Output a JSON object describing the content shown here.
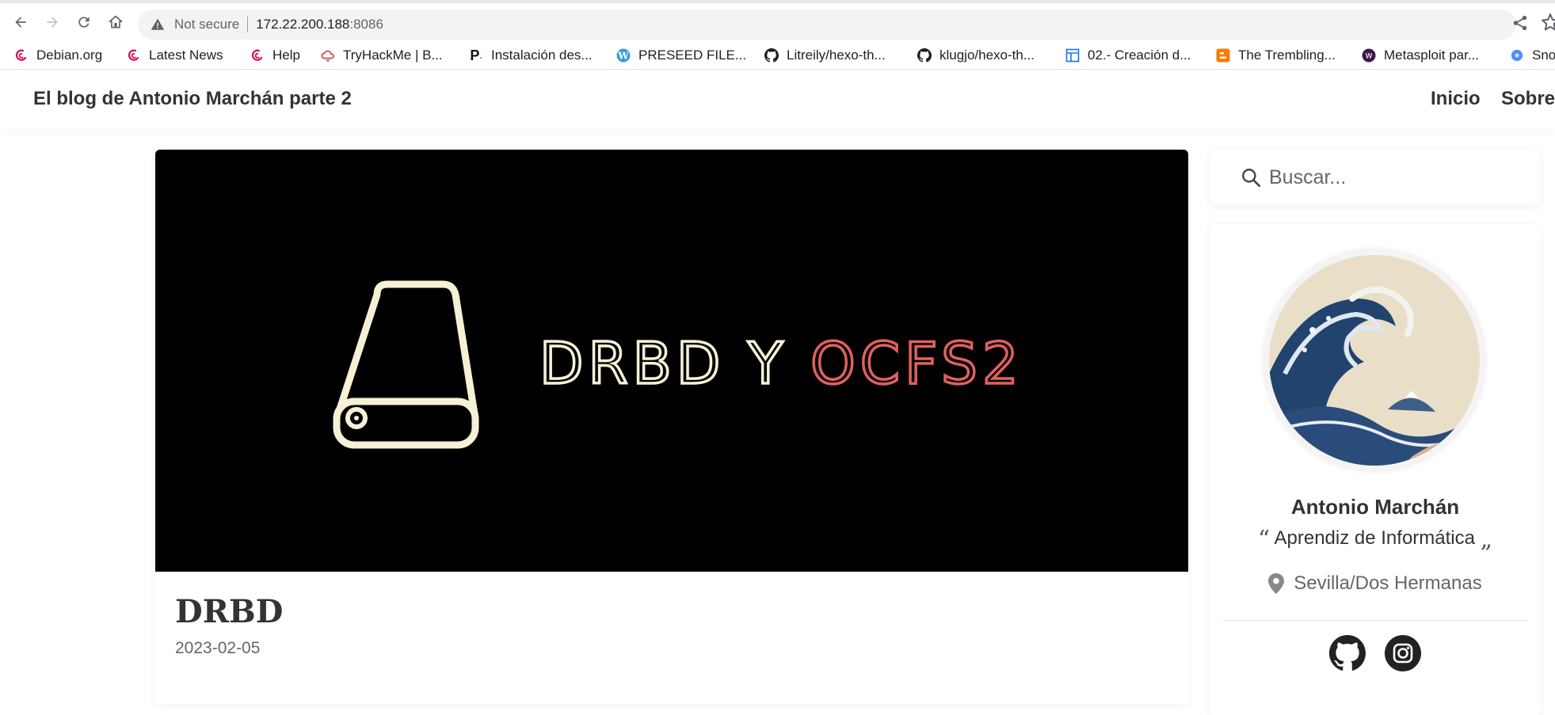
{
  "browser": {
    "security_label": "Not secure",
    "url_host": "172.22.200.188",
    "url_port": ":8086",
    "bookmarks": [
      {
        "label": "Debian.org",
        "icon": "debian-icon"
      },
      {
        "label": "Latest News",
        "icon": "debian-icon"
      },
      {
        "label": "Help",
        "icon": "debian-icon"
      },
      {
        "label": "TryHackMe | B...",
        "icon": "tryhackme-icon"
      },
      {
        "label": "Instalación des...",
        "icon": "p-logo-icon"
      },
      {
        "label": "PRESEED FILE...",
        "icon": "wordpress-icon"
      },
      {
        "label": "Litreily/hexo-th...",
        "icon": "github-icon"
      },
      {
        "label": "klugjo/hexo-th...",
        "icon": "github-icon"
      },
      {
        "label": "02.- Creación d...",
        "icon": "layout-icon"
      },
      {
        "label": "The Trembling...",
        "icon": "blogger-icon"
      },
      {
        "label": "Metasploit par...",
        "icon": "metasploit-icon"
      },
      {
        "label": "Sno",
        "icon": "blue-circle-icon"
      }
    ]
  },
  "site": {
    "title": "El blog de Antonio Marchán parte 2",
    "menu": [
      "Inicio",
      "Sobre"
    ]
  },
  "post": {
    "hero_text_part1": "DRBD Y ",
    "hero_text_part2": "OCFS2",
    "title": "DRBD",
    "date": "2023-02-05"
  },
  "sidebar": {
    "search_placeholder": "Buscar...",
    "author_name": "Antonio Marchán",
    "author_bio": "Aprendiz de Informática",
    "author_location": "Sevilla/Dos Hermanas",
    "social": [
      "github-icon",
      "instagram-icon"
    ]
  },
  "colors": {
    "hero_bg": "#000000",
    "hero_cream": "#f6f1d6",
    "hero_red": "#e0605f",
    "text": "#333333"
  }
}
